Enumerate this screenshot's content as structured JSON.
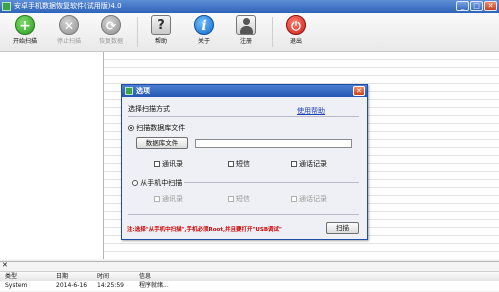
{
  "window": {
    "title": "安卓手机数据恢复软件(试用版)4.0",
    "controls": {
      "minimize": "_",
      "maximize": "□",
      "close": "✕"
    }
  },
  "toolbar": {
    "items": [
      {
        "label": "开始扫描",
        "icon": "plus-icon",
        "enabled": true
      },
      {
        "label": "停止扫描",
        "icon": "stop-icon",
        "enabled": false
      },
      {
        "label": "恢复数据",
        "icon": "recover-icon",
        "enabled": false
      },
      {
        "label": "帮助",
        "icon": "help-icon",
        "enabled": true
      },
      {
        "label": "关于",
        "icon": "info-icon",
        "enabled": true
      },
      {
        "label": "注册",
        "icon": "user-icon",
        "enabled": true
      },
      {
        "label": "退出",
        "icon": "power-icon",
        "enabled": true
      }
    ]
  },
  "dialog": {
    "title": "选项",
    "close": "✕",
    "section_label": "选择扫描方式",
    "help_link": "使用帮助",
    "option_db": {
      "label": "扫描数据库文件",
      "selected": true,
      "button": "数据库文件",
      "path_value": "",
      "checks": [
        {
          "label": "通讯录",
          "checked": false
        },
        {
          "label": "短信",
          "checked": false
        },
        {
          "label": "通话记录",
          "checked": false
        }
      ]
    },
    "option_phone": {
      "label": "从手机中扫描",
      "selected": false,
      "checks": [
        {
          "label": "通讯录",
          "checked": false
        },
        {
          "label": "短信",
          "checked": false
        },
        {
          "label": "通话记录",
          "checked": false
        }
      ]
    },
    "warning": "注:选择\"从手机中扫描\",手机必须Root,并且要打开\"USB调试\"",
    "scan_button": "扫描"
  },
  "log": {
    "close": "✕",
    "columns": [
      "类型",
      "日期",
      "时间",
      "信息"
    ],
    "rows": [
      {
        "type": "System",
        "date": "2014-6-16",
        "time": "14:25:59",
        "info": "程序就绪..."
      }
    ]
  },
  "colors": {
    "titlebar": "#2f63b8",
    "dialog_border": "#1d4ea3",
    "warning": "#d00000",
    "link": "#1f3fbf"
  }
}
